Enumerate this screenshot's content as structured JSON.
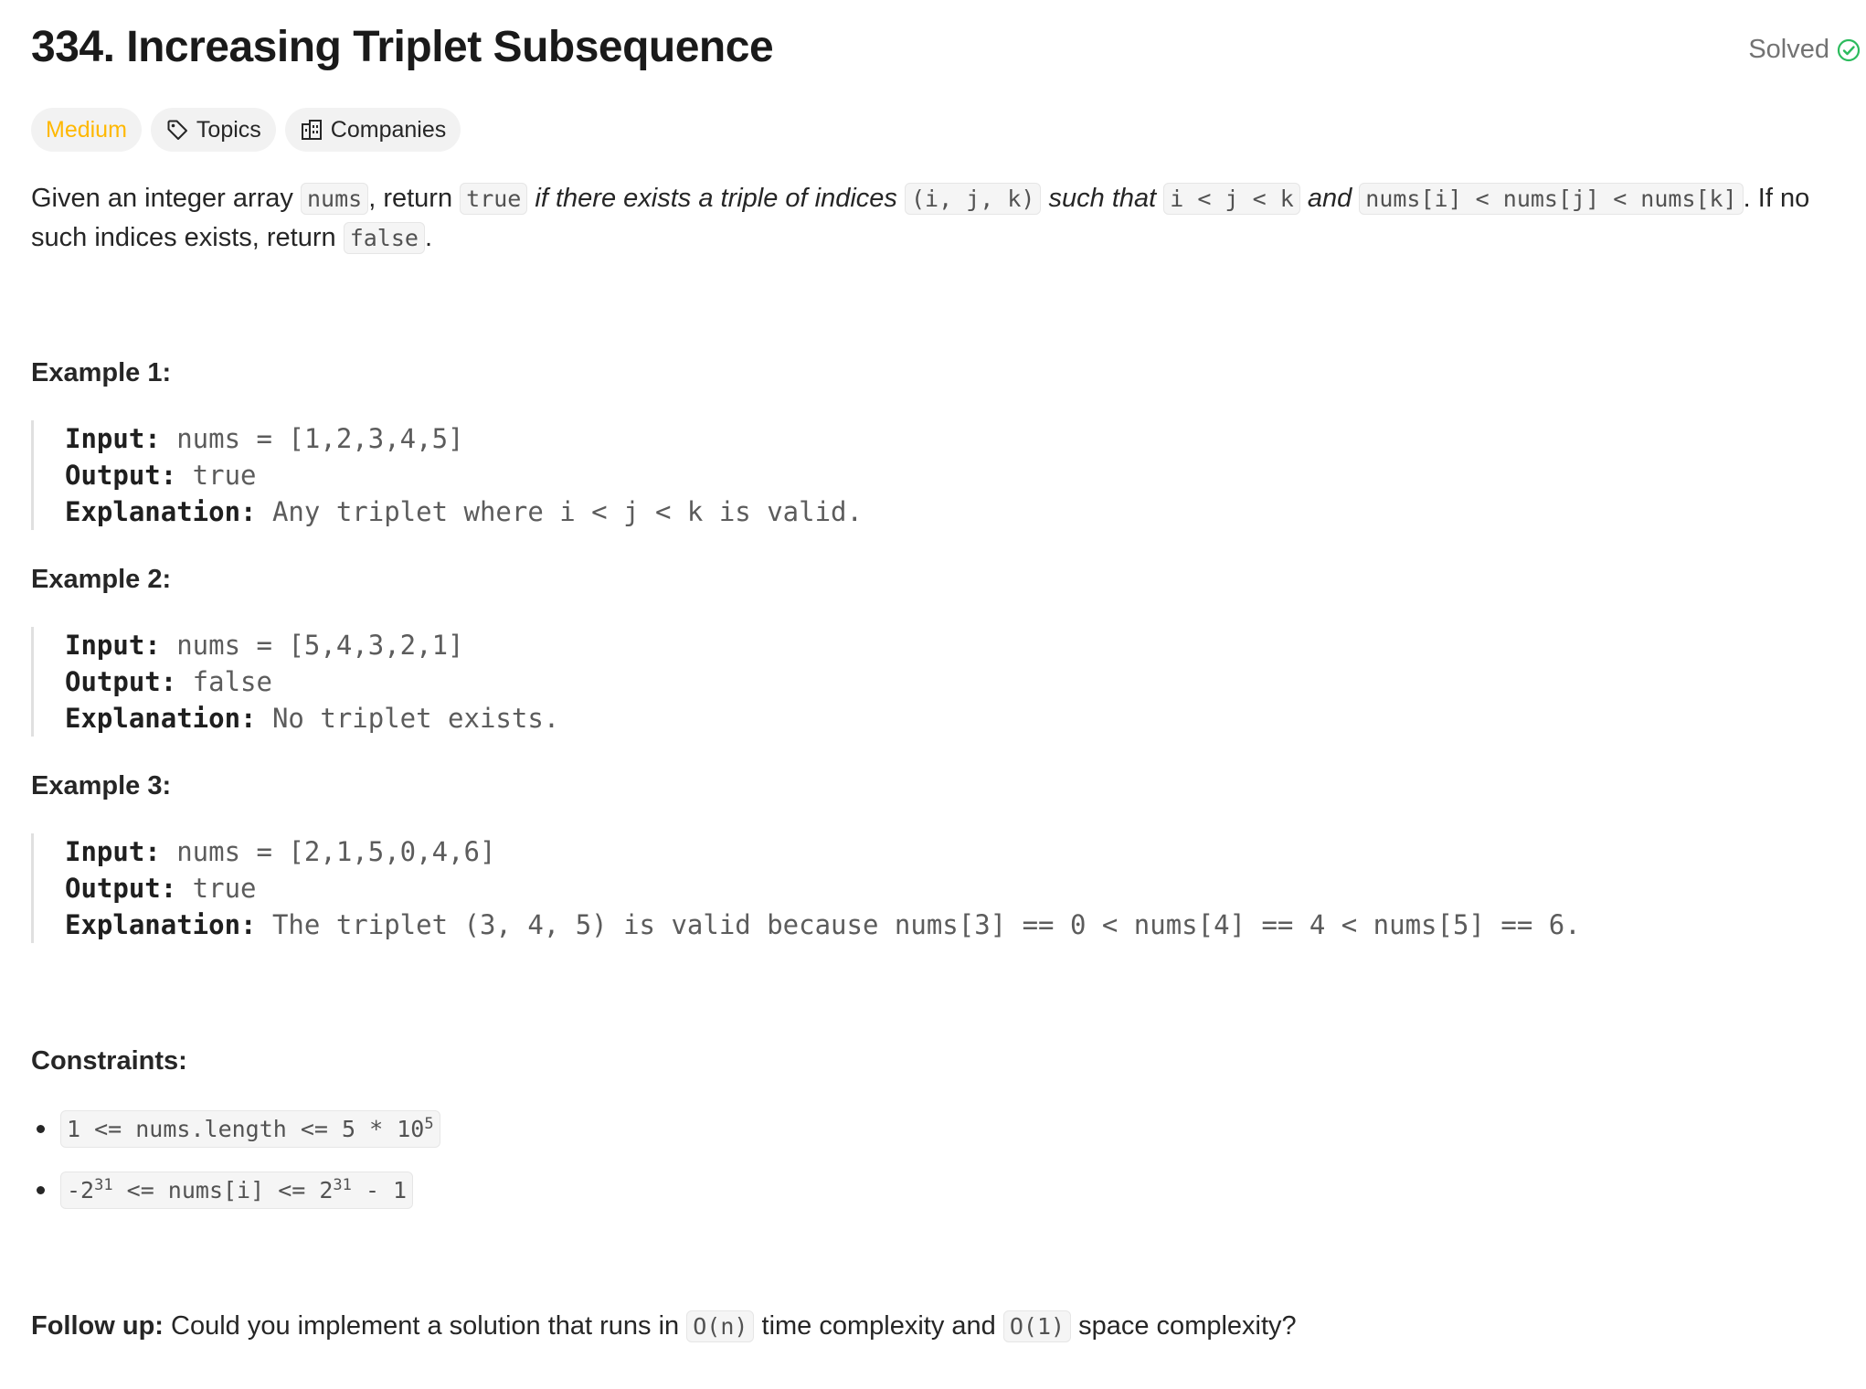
{
  "problem": {
    "title": "334. Increasing Triplet Subsequence",
    "status_label": "Solved",
    "status_color": "#2cbb5d"
  },
  "tags": {
    "difficulty": "Medium",
    "difficulty_color": "#ffb800",
    "topics": "Topics",
    "companies": "Companies"
  },
  "description": {
    "t1": "Given an integer array ",
    "c1": "nums",
    "t2": ", return ",
    "c2": "true",
    "t3": " ",
    "e1": "if there exists a triple of indices",
    "t4": " ",
    "c3": "(i, j, k)",
    "t5": " ",
    "e2": "such that",
    "t6": " ",
    "c4": "i < j < k",
    "t7": " ",
    "e3": "and",
    "t8": " ",
    "c5": "nums[i] < nums[j] < nums[k]",
    "t9": ". If no such indices exists, return ",
    "c6": "false",
    "t10": "."
  },
  "examples": [
    {
      "title": "Example 1:",
      "input_label": "Input:",
      "input_value": " nums = [1,2,3,4,5]",
      "output_label": "Output:",
      "output_value": " true",
      "explanation_label": "Explanation:",
      "explanation_value": " Any triplet where i < j < k is valid."
    },
    {
      "title": "Example 2:",
      "input_label": "Input:",
      "input_value": " nums = [5,4,3,2,1]",
      "output_label": "Output:",
      "output_value": " false",
      "explanation_label": "Explanation:",
      "explanation_value": " No triplet exists."
    },
    {
      "title": "Example 3:",
      "input_label": "Input:",
      "input_value": " nums = [2,1,5,0,4,6]",
      "output_label": "Output:",
      "output_value": " true",
      "explanation_label": "Explanation:",
      "explanation_value": " The triplet (3, 4, 5) is valid because nums[3] == 0 < nums[4] == 4 < nums[5] == 6."
    }
  ],
  "constraints": {
    "title": "Constraints:",
    "c1_pre": "1 <= nums.length <= 5 * 10",
    "c1_sup": "5",
    "c2_pre": "-2",
    "c2_sup1": "31",
    "c2_mid": " <= nums[i] <= 2",
    "c2_sup2": "31",
    "c2_post": " - 1"
  },
  "followup": {
    "label": "Follow up:",
    "t1": " Could you implement a solution that runs in ",
    "c1": "O(n)",
    "t2": " time complexity and ",
    "c2": "O(1)",
    "t3": " space complexity?"
  }
}
